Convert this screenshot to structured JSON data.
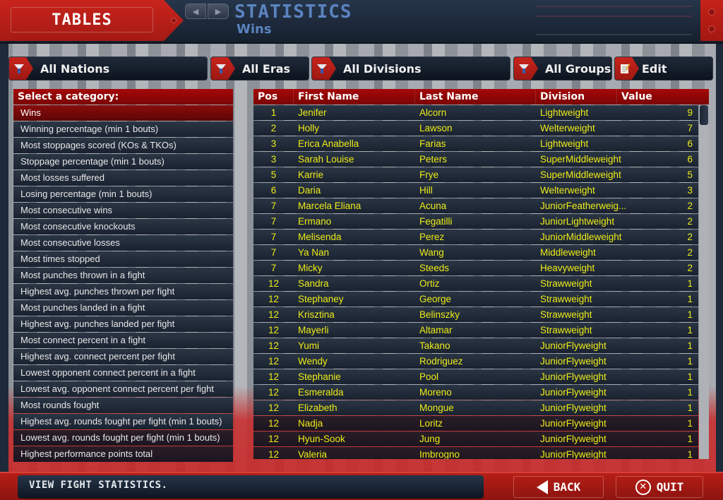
{
  "header": {
    "section_tab": "TABLES",
    "title": "STATISTICS",
    "subtitle": "Wins",
    "nav_prev_icon": "◀",
    "nav_next_icon": "▶"
  },
  "filters": [
    {
      "label": "All Nations",
      "icon": "filter-funnel-icon"
    },
    {
      "label": "All Eras",
      "icon": "filter-funnel-icon"
    },
    {
      "label": "All Divisions",
      "icon": "filter-funnel-icon"
    },
    {
      "label": "All Groups",
      "icon": "filter-funnel-icon"
    },
    {
      "label": "Edit",
      "icon": "edit-notepad-icon"
    }
  ],
  "categories": {
    "header": "Select a category:",
    "selected_index": 0,
    "items": [
      "Wins",
      "Winning percentage (min 1 bouts)",
      "Most stoppages scored (KOs & TKOs)",
      "Stoppage percentage (min 1 bouts)",
      "Most losses suffered",
      "Losing percentage (min 1 bouts)",
      "Most consecutive wins",
      "Most consecutive knockouts",
      "Most consecutive losses",
      "Most times stopped",
      "Most punches thrown in a fight",
      "Highest avg. punches thrown per fight",
      "Most punches landed in a fight",
      "Highest avg. punches landed per fight",
      "Most connect percent in a fight",
      "Highest avg. connect percent per fight",
      "Lowest opponent connect percent in a fight",
      "Lowest avg. opponent connect percent per fight",
      "Most rounds fought",
      "Highest avg. rounds fought per fight (min 1 bouts)",
      "Lowest avg. rounds fought per fight (min 1 bouts)",
      "Highest performance points total"
    ]
  },
  "table": {
    "columns": [
      "Pos",
      "First Name",
      "Last Name",
      "Division",
      "Value"
    ],
    "rows": [
      [
        "1",
        "Jenifer",
        "Alcorn",
        "Lightweight",
        "9"
      ],
      [
        "2",
        "Holly",
        "Lawson",
        "Welterweight",
        "7"
      ],
      [
        "3",
        "Erica Anabella",
        "Farias",
        "Lightweight",
        "6"
      ],
      [
        "3",
        "Sarah Louise",
        "Peters",
        "SuperMiddleweight",
        "6"
      ],
      [
        "5",
        "Karrie",
        "Frye",
        "SuperMiddleweight",
        "5"
      ],
      [
        "6",
        "Daria",
        "Hill",
        "Welterweight",
        "3"
      ],
      [
        "7",
        "Marcela Eliana",
        "Acuna",
        "JuniorFeatherweig...",
        "2"
      ],
      [
        "7",
        "Ermano",
        "Fegatilli",
        "JuniorLightweight",
        "2"
      ],
      [
        "7",
        "Melisenda",
        "Perez",
        "JuniorMiddleweight",
        "2"
      ],
      [
        "7",
        "Ya Nan",
        "Wang",
        "Middleweight",
        "2"
      ],
      [
        "7",
        "Micky",
        "Steeds",
        "Heavyweight",
        "2"
      ],
      [
        "12",
        "Sandra",
        "Ortiz",
        "Strawweight",
        "1"
      ],
      [
        "12",
        "Stephaney",
        "George",
        "Strawweight",
        "1"
      ],
      [
        "12",
        "Krisztina",
        "Belinszky",
        "Strawweight",
        "1"
      ],
      [
        "12",
        "Mayerli",
        "Altamar",
        "Strawweight",
        "1"
      ],
      [
        "12",
        "Yumi",
        "Takano",
        "JuniorFlyweight",
        "1"
      ],
      [
        "12",
        "Wendy",
        "Rodriguez",
        "JuniorFlyweight",
        "1"
      ],
      [
        "12",
        "Stephanie",
        "Pool",
        "JuniorFlyweight",
        "1"
      ],
      [
        "12",
        "Esmeralda",
        "Moreno",
        "JuniorFlyweight",
        "1"
      ],
      [
        "12",
        "Elizabeth",
        "Mongue",
        "JuniorFlyweight",
        "1"
      ],
      [
        "12",
        "Nadja",
        "Loritz",
        "JuniorFlyweight",
        "1"
      ],
      [
        "12",
        "Hyun-Sook",
        "Jung",
        "JuniorFlyweight",
        "1"
      ],
      [
        "12",
        "Valeria",
        "Imbrogno",
        "JuniorFlyweight",
        "1"
      ]
    ]
  },
  "footer": {
    "status": "VIEW FIGHT STATISTICS.",
    "back_label": "BACK",
    "quit_label": "QUIT",
    "quit_icon": "✕"
  },
  "colors": {
    "accent_red": "#a40808",
    "value_text": "#ecec18",
    "title_blue": "#5b83c0"
  }
}
